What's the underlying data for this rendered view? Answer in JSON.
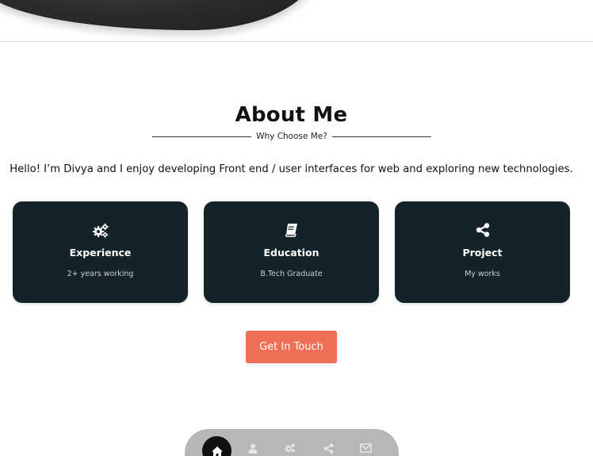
{
  "about": {
    "title": "About Me",
    "subtitle": "Why Choose Me?",
    "intro": "Hello! I’m Divya and I enjoy developing Front end / user interfaces for web and exploring new technologies."
  },
  "cards": [
    {
      "icon": "gears-icon",
      "title": "Experience",
      "description": "2+ years working"
    },
    {
      "icon": "book-icon",
      "title": "Education",
      "description": "B.Tech Graduate"
    },
    {
      "icon": "share-icon",
      "title": "Project",
      "description": "My works"
    }
  ],
  "cta": {
    "label": "Get In Touch"
  },
  "bottom_nav": {
    "items": [
      {
        "icon": "home-icon",
        "active": true
      },
      {
        "icon": "user-icon",
        "active": false
      },
      {
        "icon": "gears-icon",
        "active": false
      },
      {
        "icon": "share-icon",
        "active": false
      },
      {
        "icon": "mail-icon",
        "active": false
      }
    ]
  },
  "colors": {
    "card_background": "#14232a",
    "accent": "#ef6f56",
    "nav_background": "#b7b7b7"
  }
}
